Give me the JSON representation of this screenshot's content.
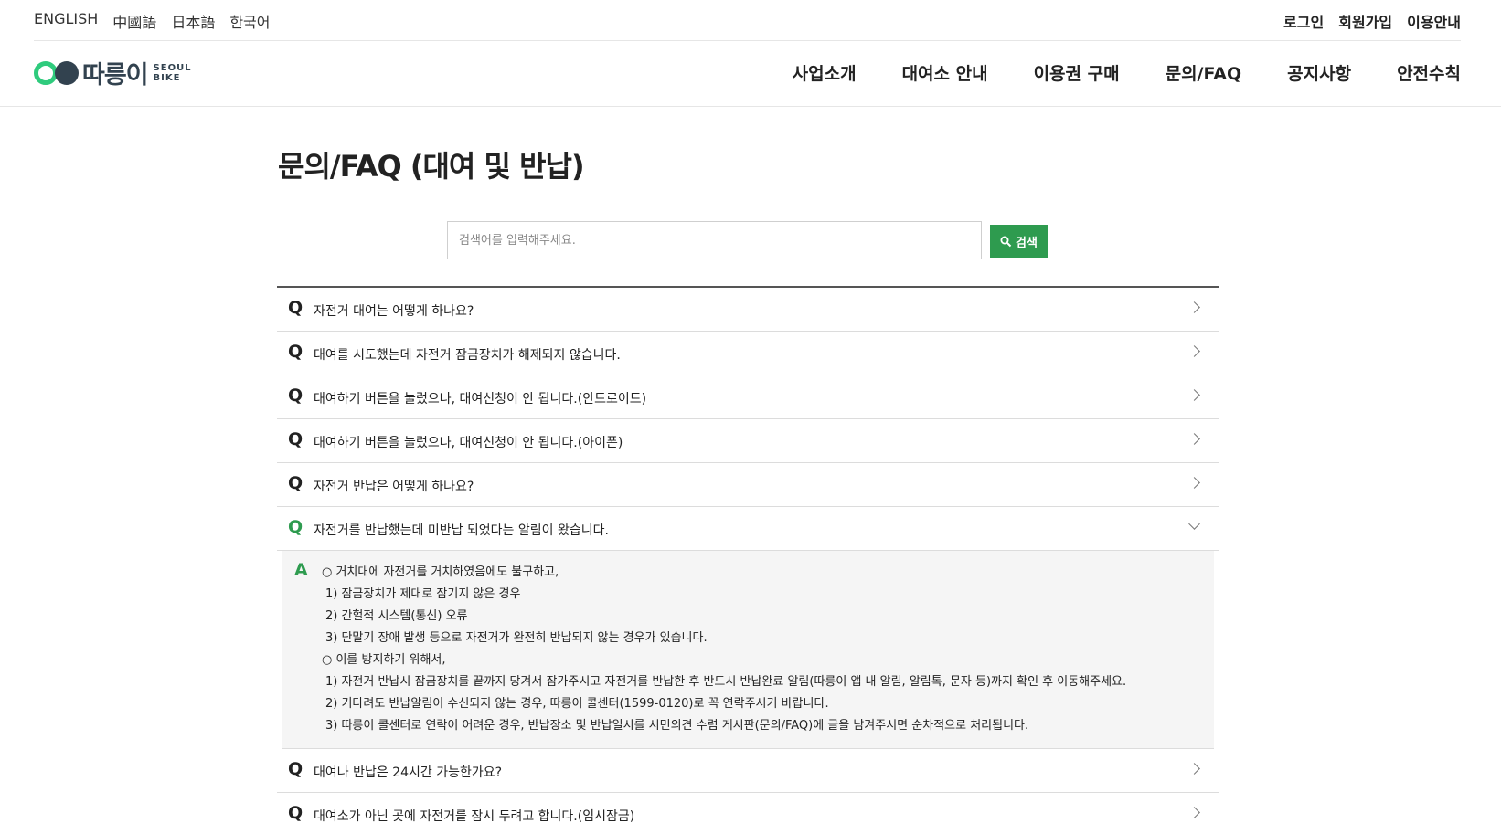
{
  "languages": [
    "ENGLISH",
    "中國語",
    "日本語",
    "한국어"
  ],
  "member_links": [
    "로그인",
    "회원가입",
    "이용안내"
  ],
  "logo": {
    "word": "따릉이",
    "sub_line1": "SEOUL",
    "sub_line2": "BIKE"
  },
  "nav": [
    "사업소개",
    "대여소 안내",
    "이용권 구매",
    "문의/FAQ",
    "공지사항",
    "안전수칙"
  ],
  "page_title": "문의/FAQ (대여 및 반납)",
  "search": {
    "placeholder": "검색어를 입력해주세요.",
    "button_label": "검색"
  },
  "faq": {
    "q_mark": "Q",
    "a_mark": "A",
    "items": [
      "자전거 대여는 어떻게 하나요?",
      "대여를 시도했는데 자전거 잠금장치가 해제되지 않습니다.",
      "대여하기 버튼을 눌렀으나, 대여신청이 안 됩니다.(안드로이드)",
      "대여하기 버튼을 눌렀으나, 대여신청이 안 됩니다.(아이폰)",
      "자전거 반납은 어떻게 하나요?",
      "자전거를 반납했는데 미반납 되었다는 알림이 왔습니다.",
      "대여나 반납은 24시간 가능한가요?",
      "대여소가 아닌 곳에 자전거를 잠시 두려고 합니다.(임시잠금)"
    ],
    "open_index": 5,
    "answer_lines": [
      "○ 거치대에 자전거를 거치하였음에도 불구하고,",
      "1) 잠금장치가 제대로 잠기지 않은 경우",
      "2) 간헐적 시스템(통신) 오류",
      "3) 단말기 장애 발생 등으로 자전거가 완전히 반납되지 않는 경우가 있습니다.",
      "○ 이를 방지하기 위해서,",
      "1) 자전거 반납시 잠금장치를 끝까지 당겨서 잠가주시고 자전거를 반납한 후 반드시 반납완료 알림(따릉이 앱 내 알림, 알림톡, 문자 등)까지 확인 후 이동해주세요.",
      "2) 기다려도 반납알림이 수신되지 않는 경우, 따릉이 콜센터(1599-0120)로 꼭 연락주시기 바랍니다.",
      "3) 따릉이 콜센터로 연락이 어려운 경우, 반납장소 및 반납일시를 시민의견 수렴 게시판(문의/FAQ)에 글을 남겨주시면 순차적으로 처리됩니다."
    ]
  },
  "colors": {
    "accent": "#2e9b4f",
    "logo_green": "#2fcb7d",
    "logo_dark": "#32424f"
  }
}
